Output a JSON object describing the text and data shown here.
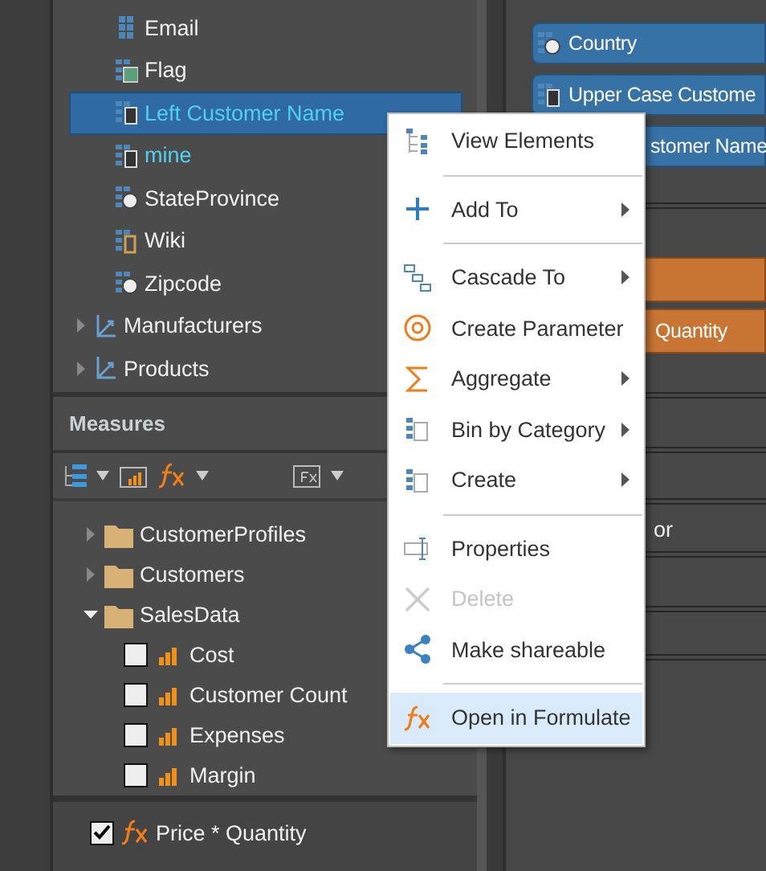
{
  "fields_tree": {
    "items": [
      {
        "label": "Email",
        "kind": "attribute",
        "calculated": false,
        "selected": false
      },
      {
        "label": "Flag",
        "kind": "image",
        "calculated": false,
        "selected": false
      },
      {
        "label": "Left Customer Name",
        "kind": "calculated",
        "calculated": true,
        "selected": true
      },
      {
        "label": "mine",
        "kind": "calculated",
        "calculated": true,
        "selected": false
      },
      {
        "label": "StateProvince",
        "kind": "geo",
        "calculated": false,
        "selected": false
      },
      {
        "label": "Wiki",
        "kind": "link",
        "calculated": false,
        "selected": false
      },
      {
        "label": "Zipcode",
        "kind": "geo",
        "calculated": false,
        "selected": false
      }
    ],
    "hierarchies": [
      {
        "label": "Manufacturers",
        "expanded": false
      },
      {
        "label": "Products",
        "expanded": false
      }
    ]
  },
  "measures": {
    "title": "Measures",
    "tree": [
      {
        "label": "CustomerProfiles",
        "expanded": false
      },
      {
        "label": "Customers",
        "expanded": false
      },
      {
        "label": "SalesData",
        "expanded": true,
        "children": [
          {
            "label": "Cost",
            "checked": false
          },
          {
            "label": "Customer Count",
            "checked": false
          },
          {
            "label": "Expenses",
            "checked": false
          },
          {
            "label": "Margin",
            "checked": false
          }
        ]
      }
    ],
    "selected_measures": [
      {
        "label": "Price * Quantity",
        "checked": true
      }
    ]
  },
  "drop_zones": {
    "chips": [
      {
        "label": "Country",
        "kind": "geo",
        "color": "#3672a6"
      },
      {
        "label": "Upper Case Custome",
        "kind": "calculated",
        "color": "#3672a6"
      },
      {
        "label": "stomer Name",
        "kind": "none",
        "color": "#3672a6"
      }
    ],
    "measure_chips": [
      {
        "color": "#c87533"
      },
      {
        "label": "Quantity",
        "color": "#c87533"
      }
    ],
    "extra_row": {
      "label": "or"
    }
  },
  "context_menu": {
    "items": [
      {
        "kind": "view",
        "label": "View Elements",
        "submenu": false,
        "disabled": false,
        "selected": false
      },
      {
        "kind": "separator"
      },
      {
        "kind": "add",
        "label": "Add To",
        "submenu": true,
        "disabled": false,
        "selected": false
      },
      {
        "kind": "separator"
      },
      {
        "kind": "cascade",
        "label": "Cascade To",
        "submenu": true,
        "disabled": false,
        "selected": false
      },
      {
        "kind": "parameter",
        "label": "Create Parameter",
        "submenu": false,
        "disabled": false,
        "selected": false
      },
      {
        "kind": "aggregate",
        "label": "Aggregate",
        "submenu": true,
        "disabled": false,
        "selected": false
      },
      {
        "kind": "bin",
        "label": "Bin by Category",
        "submenu": true,
        "disabled": false,
        "selected": false
      },
      {
        "kind": "create",
        "label": "Create",
        "submenu": true,
        "disabled": false,
        "selected": false
      },
      {
        "kind": "separator"
      },
      {
        "kind": "properties",
        "label": "Properties",
        "submenu": false,
        "disabled": false,
        "selected": false
      },
      {
        "kind": "delete",
        "label": "Delete",
        "submenu": false,
        "disabled": true,
        "selected": false
      },
      {
        "kind": "share",
        "label": "Make shareable",
        "submenu": false,
        "disabled": false,
        "selected": false
      },
      {
        "kind": "separator"
      },
      {
        "kind": "formula",
        "label": "Open in Formulate",
        "submenu": false,
        "disabled": false,
        "selected": true
      }
    ]
  }
}
